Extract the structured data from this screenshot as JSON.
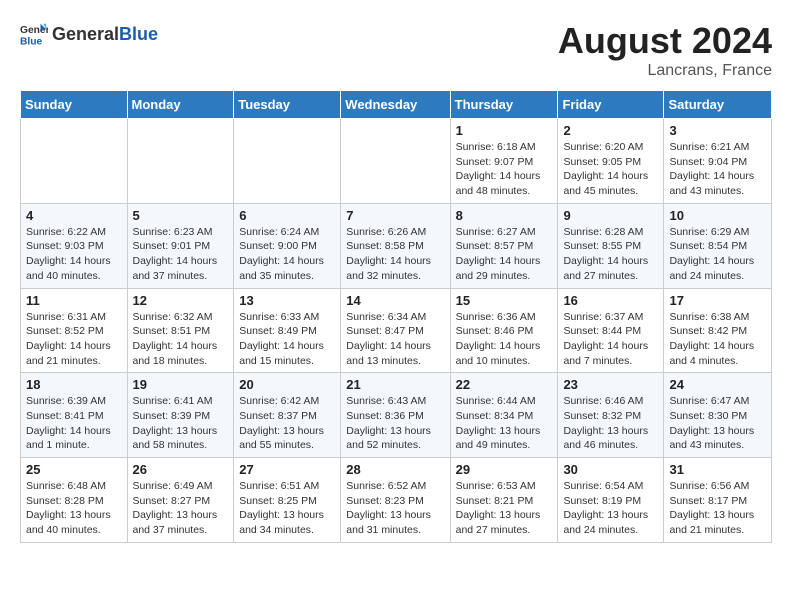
{
  "header": {
    "logo_general": "General",
    "logo_blue": "Blue",
    "month_year": "August 2024",
    "location": "Lancrans, France"
  },
  "days_of_week": [
    "Sunday",
    "Monday",
    "Tuesday",
    "Wednesday",
    "Thursday",
    "Friday",
    "Saturday"
  ],
  "weeks": [
    [
      {
        "day": "",
        "info": ""
      },
      {
        "day": "",
        "info": ""
      },
      {
        "day": "",
        "info": ""
      },
      {
        "day": "",
        "info": ""
      },
      {
        "day": "1",
        "info": "Sunrise: 6:18 AM\nSunset: 9:07 PM\nDaylight: 14 hours and 48 minutes."
      },
      {
        "day": "2",
        "info": "Sunrise: 6:20 AM\nSunset: 9:05 PM\nDaylight: 14 hours and 45 minutes."
      },
      {
        "day": "3",
        "info": "Sunrise: 6:21 AM\nSunset: 9:04 PM\nDaylight: 14 hours and 43 minutes."
      }
    ],
    [
      {
        "day": "4",
        "info": "Sunrise: 6:22 AM\nSunset: 9:03 PM\nDaylight: 14 hours and 40 minutes."
      },
      {
        "day": "5",
        "info": "Sunrise: 6:23 AM\nSunset: 9:01 PM\nDaylight: 14 hours and 37 minutes."
      },
      {
        "day": "6",
        "info": "Sunrise: 6:24 AM\nSunset: 9:00 PM\nDaylight: 14 hours and 35 minutes."
      },
      {
        "day": "7",
        "info": "Sunrise: 6:26 AM\nSunset: 8:58 PM\nDaylight: 14 hours and 32 minutes."
      },
      {
        "day": "8",
        "info": "Sunrise: 6:27 AM\nSunset: 8:57 PM\nDaylight: 14 hours and 29 minutes."
      },
      {
        "day": "9",
        "info": "Sunrise: 6:28 AM\nSunset: 8:55 PM\nDaylight: 14 hours and 27 minutes."
      },
      {
        "day": "10",
        "info": "Sunrise: 6:29 AM\nSunset: 8:54 PM\nDaylight: 14 hours and 24 minutes."
      }
    ],
    [
      {
        "day": "11",
        "info": "Sunrise: 6:31 AM\nSunset: 8:52 PM\nDaylight: 14 hours and 21 minutes."
      },
      {
        "day": "12",
        "info": "Sunrise: 6:32 AM\nSunset: 8:51 PM\nDaylight: 14 hours and 18 minutes."
      },
      {
        "day": "13",
        "info": "Sunrise: 6:33 AM\nSunset: 8:49 PM\nDaylight: 14 hours and 15 minutes."
      },
      {
        "day": "14",
        "info": "Sunrise: 6:34 AM\nSunset: 8:47 PM\nDaylight: 14 hours and 13 minutes."
      },
      {
        "day": "15",
        "info": "Sunrise: 6:36 AM\nSunset: 8:46 PM\nDaylight: 14 hours and 10 minutes."
      },
      {
        "day": "16",
        "info": "Sunrise: 6:37 AM\nSunset: 8:44 PM\nDaylight: 14 hours and 7 minutes."
      },
      {
        "day": "17",
        "info": "Sunrise: 6:38 AM\nSunset: 8:42 PM\nDaylight: 14 hours and 4 minutes."
      }
    ],
    [
      {
        "day": "18",
        "info": "Sunrise: 6:39 AM\nSunset: 8:41 PM\nDaylight: 14 hours and 1 minute."
      },
      {
        "day": "19",
        "info": "Sunrise: 6:41 AM\nSunset: 8:39 PM\nDaylight: 13 hours and 58 minutes."
      },
      {
        "day": "20",
        "info": "Sunrise: 6:42 AM\nSunset: 8:37 PM\nDaylight: 13 hours and 55 minutes."
      },
      {
        "day": "21",
        "info": "Sunrise: 6:43 AM\nSunset: 8:36 PM\nDaylight: 13 hours and 52 minutes."
      },
      {
        "day": "22",
        "info": "Sunrise: 6:44 AM\nSunset: 8:34 PM\nDaylight: 13 hours and 49 minutes."
      },
      {
        "day": "23",
        "info": "Sunrise: 6:46 AM\nSunset: 8:32 PM\nDaylight: 13 hours and 46 minutes."
      },
      {
        "day": "24",
        "info": "Sunrise: 6:47 AM\nSunset: 8:30 PM\nDaylight: 13 hours and 43 minutes."
      }
    ],
    [
      {
        "day": "25",
        "info": "Sunrise: 6:48 AM\nSunset: 8:28 PM\nDaylight: 13 hours and 40 minutes."
      },
      {
        "day": "26",
        "info": "Sunrise: 6:49 AM\nSunset: 8:27 PM\nDaylight: 13 hours and 37 minutes."
      },
      {
        "day": "27",
        "info": "Sunrise: 6:51 AM\nSunset: 8:25 PM\nDaylight: 13 hours and 34 minutes."
      },
      {
        "day": "28",
        "info": "Sunrise: 6:52 AM\nSunset: 8:23 PM\nDaylight: 13 hours and 31 minutes."
      },
      {
        "day": "29",
        "info": "Sunrise: 6:53 AM\nSunset: 8:21 PM\nDaylight: 13 hours and 27 minutes."
      },
      {
        "day": "30",
        "info": "Sunrise: 6:54 AM\nSunset: 8:19 PM\nDaylight: 13 hours and 24 minutes."
      },
      {
        "day": "31",
        "info": "Sunrise: 6:56 AM\nSunset: 8:17 PM\nDaylight: 13 hours and 21 minutes."
      }
    ]
  ]
}
